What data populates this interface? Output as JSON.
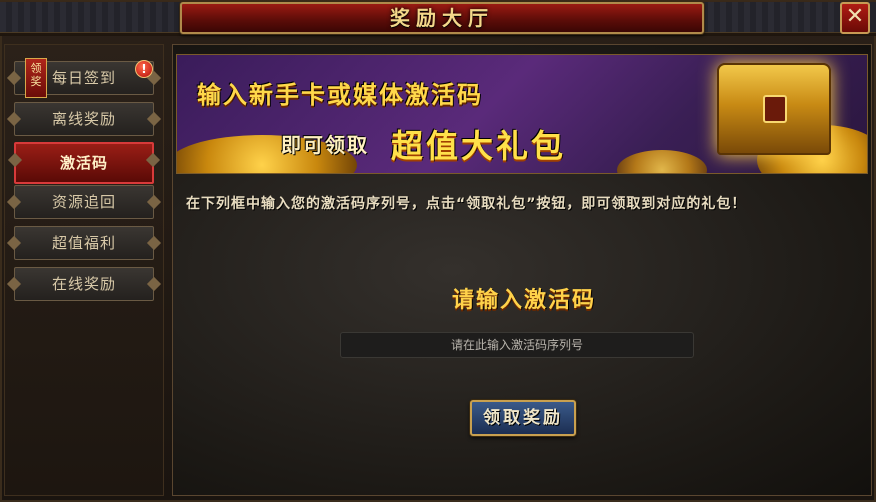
{
  "window": {
    "title": "奖励大厅",
    "close_label": "✕"
  },
  "sidebar": {
    "items": [
      {
        "label": "每日签到",
        "tag": "领奖",
        "alert": "!"
      },
      {
        "label": "离线奖励"
      },
      {
        "label": "激活码",
        "active": true
      },
      {
        "label": "资源追回"
      },
      {
        "label": "超值福利"
      },
      {
        "label": "在线奖励"
      }
    ]
  },
  "banner": {
    "line1": "输入新手卡或媒体激活码",
    "line2_prefix": "即可领取",
    "line2_highlight": "超值大礼包"
  },
  "main": {
    "instruction": "在下列框中输入您的激活码序列号，点击“领取礼包”按钮，即可领取到对应的礼包！",
    "prompt": "请输入激活码",
    "input_placeholder": "请在此输入激活码序列号",
    "input_value": "",
    "claim_button": "领取奖励"
  },
  "colors": {
    "accent_gold": "#ffd24a",
    "active_red": "#d83a3a",
    "button_blue": "#2a4470"
  }
}
